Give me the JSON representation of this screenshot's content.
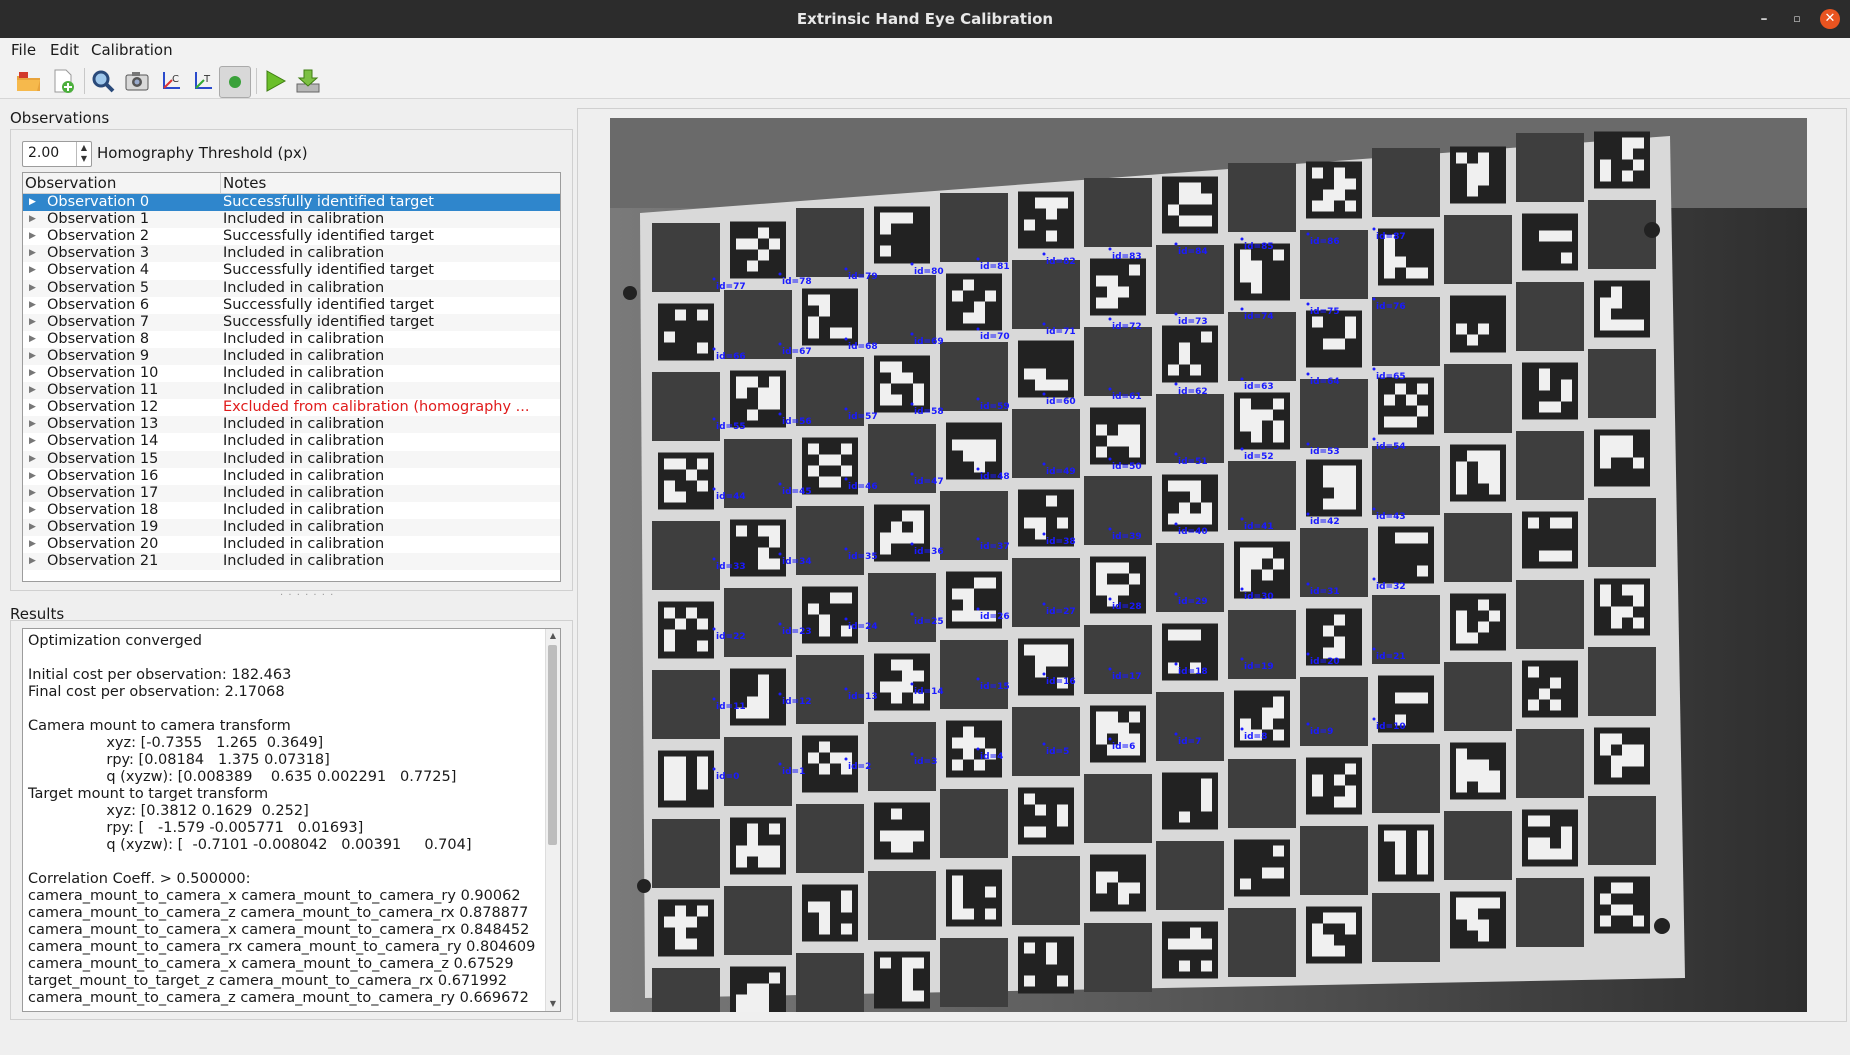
{
  "window": {
    "title": "Extrinsic Hand Eye Calibration"
  },
  "menu": [
    "File",
    "Edit",
    "Calibration"
  ],
  "toolbar": {
    "icons": [
      "open-folder-icon",
      "new-file-icon",
      "search-icon",
      "camera-icon",
      "camera-intrinsics-icon",
      "target-axes-icon",
      "record-circle-icon",
      "play-icon",
      "download-icon"
    ],
    "accent": "#2f86cc"
  },
  "observations": {
    "label": "Observations",
    "threshold_value": "2.00",
    "threshold_label": "Homography Threshold (px)",
    "columns": [
      "Observation",
      "Notes"
    ],
    "rows": [
      {
        "name": "Observation 0",
        "note": "Successfully identified target"
      },
      {
        "name": "Observation 1",
        "note": "Included in calibration"
      },
      {
        "name": "Observation 2",
        "note": "Successfully identified target"
      },
      {
        "name": "Observation 3",
        "note": "Included in calibration"
      },
      {
        "name": "Observation 4",
        "note": "Successfully identified target"
      },
      {
        "name": "Observation 5",
        "note": "Included in calibration"
      },
      {
        "name": "Observation 6",
        "note": "Successfully identified target"
      },
      {
        "name": "Observation 7",
        "note": "Successfully identified target"
      },
      {
        "name": "Observation 8",
        "note": "Included in calibration"
      },
      {
        "name": "Observation 9",
        "note": "Included in calibration"
      },
      {
        "name": "Observation 10",
        "note": "Included in calibration"
      },
      {
        "name": "Observation 11",
        "note": "Included in calibration"
      },
      {
        "name": "Observation 12",
        "note": "Excluded from calibration (homography ..."
      },
      {
        "name": "Observation 13",
        "note": "Included in calibration"
      },
      {
        "name": "Observation 14",
        "note": "Included in calibration"
      },
      {
        "name": "Observation 15",
        "note": "Included in calibration"
      },
      {
        "name": "Observation 16",
        "note": "Included in calibration"
      },
      {
        "name": "Observation 17",
        "note": "Included in calibration"
      },
      {
        "name": "Observation 18",
        "note": "Included in calibration"
      },
      {
        "name": "Observation 19",
        "note": "Included in calibration"
      },
      {
        "name": "Observation 20",
        "note": "Included in calibration"
      },
      {
        "name": "Observation 21",
        "note": "Included in calibration"
      }
    ],
    "selected_row": 0,
    "error_row": 12,
    "error_color": "#e01b1b"
  },
  "results": {
    "label": "Results",
    "lines": [
      "Optimization converged",
      "",
      "Initial cost per observation: 182.463",
      "Final cost per observation: 2.17068",
      "",
      "Camera mount to camera transform",
      "\t\txyz: [-0.7355   1.265  0.3649]",
      "\t\trpy: [0.08184   1.375 0.07318]",
      "\t\tq (xyzw): [0.008389    0.635 0.002291   0.7725]",
      "Target mount to target transform",
      "\t\txyz: [0.3812 0.1629  0.252]",
      "\t\trpy: [   -1.579 -0.005771   0.01693]",
      "\t\tq (xyzw): [  -0.7101 -0.008042   0.00391     0.704]",
      "",
      "Correlation Coeff. > 0.500000:",
      "camera_mount_to_camera_x camera_mount_to_camera_ry 0.90062",
      "camera_mount_to_camera_z camera_mount_to_camera_rx 0.878877",
      "camera_mount_to_camera_x camera_mount_to_camera_rx 0.848452",
      "camera_mount_to_camera_rx camera_mount_to_camera_ry 0.804609",
      "camera_mount_to_camera_x camera_mount_to_camera_z 0.67529",
      "target_mount_to_target_z camera_mount_to_camera_rx 0.671992",
      "camera_mount_to_camera_z camera_mount_to_camera_ry 0.669672"
    ]
  },
  "image": {
    "marker_ids": [
      [
        77,
        78,
        79,
        80,
        81,
        82,
        83,
        84,
        85,
        86,
        87
      ],
      [
        66,
        67,
        68,
        69,
        70,
        71,
        72,
        73,
        74,
        75,
        76
      ],
      [
        55,
        56,
        57,
        58,
        59,
        60,
        61,
        62,
        63,
        64,
        65
      ],
      [
        44,
        45,
        46,
        47,
        48,
        49,
        50,
        51,
        52,
        53,
        54
      ],
      [
        33,
        34,
        35,
        36,
        37,
        38,
        39,
        40,
        41,
        42,
        43
      ],
      [
        22,
        23,
        24,
        25,
        26,
        27,
        28,
        29,
        30,
        31,
        32
      ],
      [
        11,
        12,
        13,
        14,
        15,
        16,
        17,
        18,
        19,
        20,
        21
      ],
      [
        0,
        1,
        2,
        3,
        4,
        5,
        6,
        7,
        8,
        9,
        10
      ]
    ],
    "label_prefix": "id=",
    "label_color": "#1a1aff"
  }
}
